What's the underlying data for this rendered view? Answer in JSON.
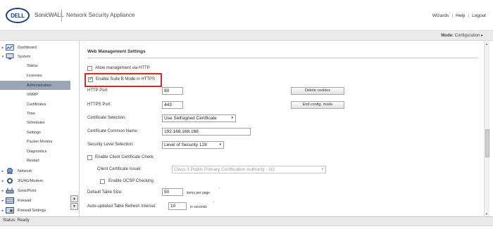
{
  "header": {
    "logo_text": "DELL",
    "brand": "SonicWALL",
    "title": "Network Security Appliance",
    "links": [
      "Wizards",
      "Help",
      "Logout"
    ]
  },
  "modebar": {
    "mode_label": "Mode:",
    "mode_value": "Configuration ▸"
  },
  "sidebar": {
    "items": [
      {
        "label": "Dashboard",
        "arrow": "▸",
        "icon": "dashboard-icon"
      },
      {
        "label": "System",
        "arrow": "▾",
        "icon": "system-icon"
      },
      {
        "label": "Network",
        "arrow": "▸",
        "icon": "network-icon"
      },
      {
        "label": "3G/4G/Modem",
        "arrow": "▸",
        "icon": "modem-icon"
      },
      {
        "label": "SonicPoint",
        "arrow": "▸",
        "icon": "sonicpoint-icon"
      },
      {
        "label": "Firewall",
        "arrow": "▸",
        "icon": "firewall-icon"
      },
      {
        "label": "Firewall Settings",
        "arrow": "▸",
        "icon": "firewall-settings-icon"
      }
    ],
    "system_sub": [
      "Status",
      "Licenses",
      "Administration",
      "SNMP",
      "Certificates",
      "Time",
      "Schedules",
      "Settings",
      "Packet Monitor",
      "Diagnostics",
      "Restart"
    ],
    "scroll_up": "▲",
    "scroll_down": "▼"
  },
  "content": {
    "section_title": "Web Management Settings",
    "allow_http_label": "Allow management via HTTP",
    "suite_b_label": "Enable Suite B Mode in HTTPS",
    "http_port_label": "HTTP Port:",
    "http_port_value": "80",
    "https_port_label": "HTTPS Port:",
    "https_port_value": "443",
    "delete_cookies": "Delete cookies",
    "end_config_mode": "End config. mode",
    "cert_selection_label": "Certificate Selection:",
    "cert_selection_value": "Use Selfsigned Certificate",
    "cert_common_name_label": "Certificate Common Name:",
    "cert_common_name_value": "192.168.168.168",
    "security_level_label": "Security Level Selection:",
    "security_level_value": "Level of Security 128",
    "client_cert_check_label": "Enable Client Certificate Check",
    "client_cert_issuer_label": "Client Certificate Issuer:",
    "client_cert_issuer_value": "Class 3 Public Primary Certification Authority - G2",
    "ocsp_label": "Enable OCSP Checking",
    "default_table_size_label": "Default Table Size:",
    "default_table_size_value": "50",
    "items_per_page": "items per page",
    "refresh_interval_label": "Auto-updated Table Refresh Interval:",
    "refresh_interval_value": "10",
    "in_seconds": "in seconds",
    "caret": "▾",
    "hint_mark": "′"
  },
  "status": {
    "text": "Status: Ready"
  },
  "colors": {
    "highlight": "#d22b2b",
    "selected_nav": "#9aa6b6",
    "dell_blue": "#1a3f8f"
  }
}
